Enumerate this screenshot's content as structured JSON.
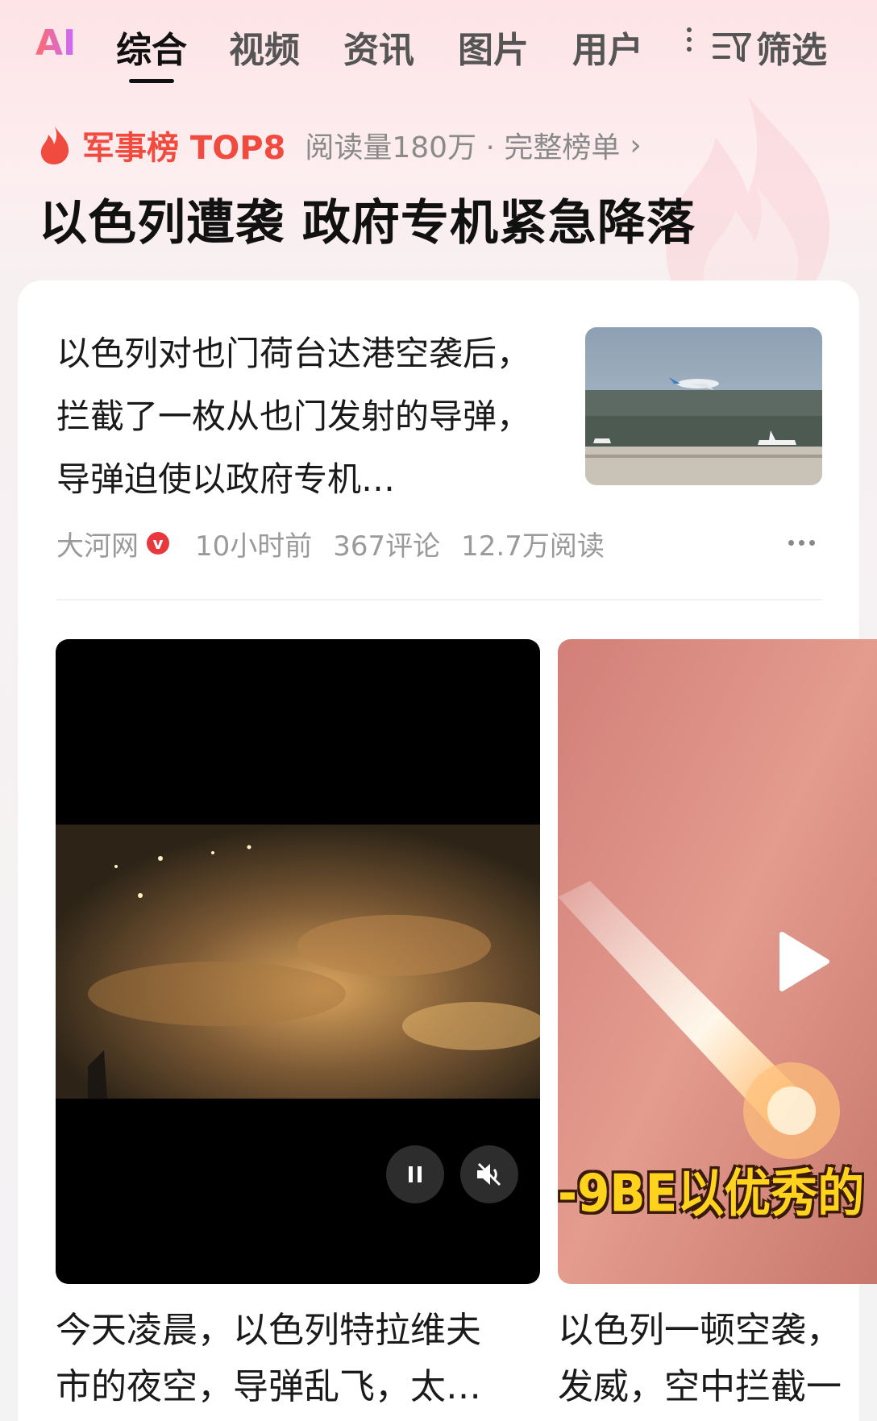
{
  "tabs": {
    "ai_label": "AI",
    "items": [
      {
        "label": "综合"
      },
      {
        "label": "视频"
      },
      {
        "label": "资讯"
      },
      {
        "label": "图片"
      },
      {
        "label": "用户"
      }
    ],
    "active_index": 0,
    "filter_label": "筛选"
  },
  "hot_rank": {
    "title": "军事榜 TOP8",
    "meta": "阅读量180万 · 完整榜单",
    "headline": "以色列遭袭 政府专机紧急降落"
  },
  "article": {
    "text": "以色列对也门荷台达港空袭后，拦截了一枚从也门发射的导弹，导弹迫使以政府专机…",
    "source": "大河网",
    "verified_mark": "v",
    "time": "10小时前",
    "comments": "367评论",
    "reads": "12.7万阅读"
  },
  "videos": [
    {
      "title_line1": "今天凌晨，以色列特拉维夫",
      "title_line2": "市的夜空，导弹乱飞，太…"
    },
    {
      "caption": "-9BE以优秀的",
      "title_line1": "以色列一顿空袭，",
      "title_line2": "发威，空中拦截一"
    }
  ],
  "colors": {
    "accent": "#f14b3f",
    "badge": "#e8383d",
    "caption": "#ffd21e"
  }
}
